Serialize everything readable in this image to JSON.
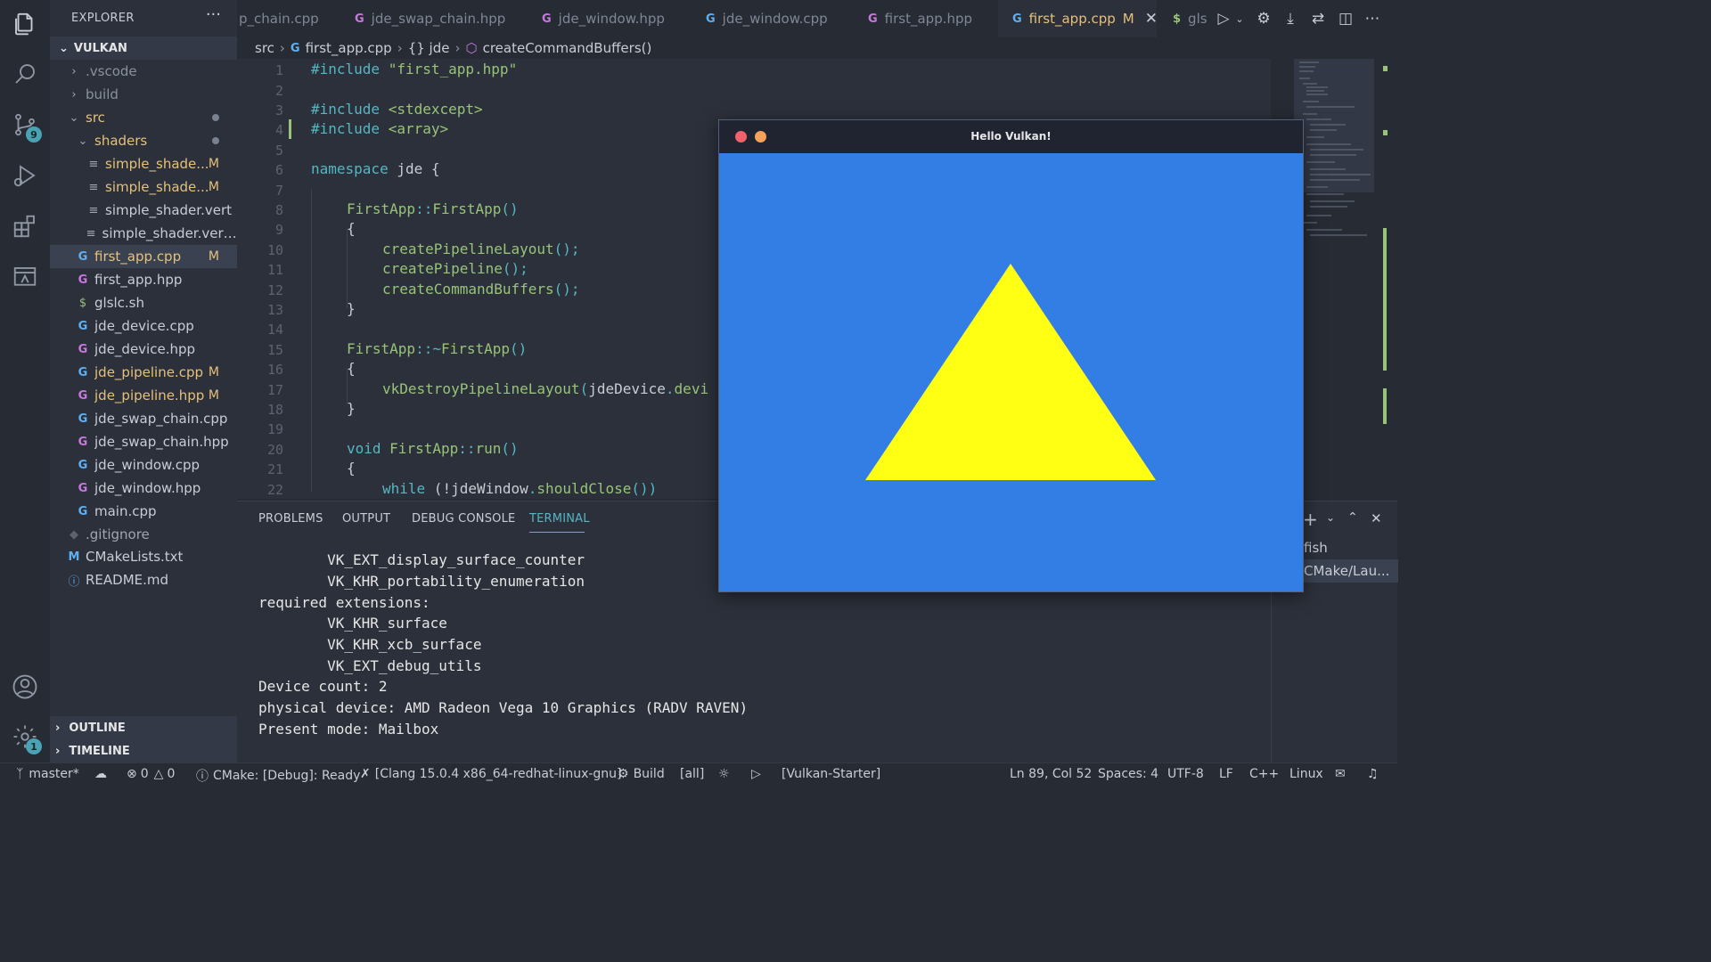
{
  "sidebar": {
    "title": "EXPLORER",
    "more": "···",
    "root": "VULKAN",
    "items": [
      {
        "label": ".vscode",
        "kind": "folder",
        "mark": ""
      },
      {
        "label": "build",
        "kind": "folder",
        "mark": ""
      },
      {
        "label": "src",
        "kind": "folder-open",
        "mark": "dot"
      },
      {
        "label": "shaders",
        "kind": "folder-open",
        "mark": "dot"
      },
      {
        "label": "simple_shade...",
        "kind": "text",
        "mark": "M"
      },
      {
        "label": "simple_shade...",
        "kind": "text",
        "mark": "M"
      },
      {
        "label": "simple_shader.vert",
        "kind": "text",
        "mark": ""
      },
      {
        "label": "simple_shader.vert....",
        "kind": "text",
        "mark": ""
      },
      {
        "label": "first_app.cpp",
        "kind": "cpp",
        "mark": "M"
      },
      {
        "label": "first_app.hpp",
        "kind": "hpp",
        "mark": ""
      },
      {
        "label": "glslc.sh",
        "kind": "sh",
        "mark": ""
      },
      {
        "label": "jde_device.cpp",
        "kind": "cpp",
        "mark": ""
      },
      {
        "label": "jde_device.hpp",
        "kind": "hpp",
        "mark": ""
      },
      {
        "label": "jde_pipeline.cpp",
        "kind": "cpp",
        "mark": "M"
      },
      {
        "label": "jde_pipeline.hpp",
        "kind": "hpp",
        "mark": "M"
      },
      {
        "label": "jde_swap_chain.cpp",
        "kind": "cpp",
        "mark": ""
      },
      {
        "label": "jde_swap_chain.hpp",
        "kind": "hpp",
        "mark": ""
      },
      {
        "label": "jde_window.cpp",
        "kind": "cpp",
        "mark": ""
      },
      {
        "label": "jde_window.hpp",
        "kind": "hpp",
        "mark": ""
      },
      {
        "label": "main.cpp",
        "kind": "cpp",
        "mark": ""
      },
      {
        "label": ".gitignore",
        "kind": "git",
        "mark": ""
      },
      {
        "label": "CMakeLists.txt",
        "kind": "cmake",
        "mark": ""
      },
      {
        "label": "README.md",
        "kind": "info",
        "mark": ""
      }
    ],
    "outline": "OUTLINE",
    "timeline": "TIMELINE",
    "scm_badge": "9",
    "settings_badge": "1"
  },
  "tabs": [
    {
      "label": "p_chain.cpp",
      "icon": ""
    },
    {
      "label": "jde_swap_chain.hpp",
      "icon": "hpp"
    },
    {
      "label": "jde_window.hpp",
      "icon": "hpp"
    },
    {
      "label": "jde_window.cpp",
      "icon": "cpp"
    },
    {
      "label": "first_app.hpp",
      "icon": "hpp"
    },
    {
      "label": "first_app.cpp",
      "icon": "cpp",
      "mark": "M"
    },
    {
      "label": "gls",
      "icon": "sh"
    }
  ],
  "breadcrumb": {
    "folder": "src",
    "file": "first_app.cpp",
    "namespace": "{} jde",
    "symbol": "createCommandBuffers()"
  },
  "editor": {
    "lines": [
      "1",
      "2",
      "3",
      "4",
      "5",
      "6",
      "7",
      "8",
      "9",
      "10",
      "11",
      "12",
      "13",
      "14",
      "15",
      "16",
      "17",
      "18",
      "19",
      "20",
      "21",
      "22"
    ],
    "code": {
      "l1_kw": "#include",
      "l1_str": "\"first_app.hpp\"",
      "l3_kw": "#include",
      "l3_str": "<stdexcept>",
      "l4_kw": "#include",
      "l4_str": "<array>",
      "l6_kw": "namespace",
      "l6_name": "jde",
      "l6_brace": "{",
      "l8_cls": "FirstApp",
      "l8_sep": "::",
      "l8_fn": "FirstApp",
      "l8_paren": "()",
      "l9": "{",
      "l10_fn": "createPipelineLayout",
      "l10_rest": "();",
      "l11_fn": "createPipeline",
      "l11_rest": "();",
      "l12_fn": "createCommandBuffers",
      "l12_rest": "();",
      "l13": "}",
      "l15_cls": "FirstApp",
      "l15_sep": "::~",
      "l15_fn": "FirstApp",
      "l15_paren": "()",
      "l16": "{",
      "l17_fn": "vkDestroyPipelineLayout",
      "l17_paren": "(",
      "l17_var": "jdeDevice",
      "l17_dot": ".",
      "l17_fn2": "devi",
      "l18": "}",
      "l20_kw": "void",
      "l20_cls": "FirstApp",
      "l20_sep": "::",
      "l20_fn": "run",
      "l20_paren": "()",
      "l21": "{",
      "l22_kw": "while",
      "l22_a": " (!",
      "l22_var": "jdeWindow",
      "l22_dot": ".",
      "l22_fn": "shouldClose",
      "l22_paren": "())"
    }
  },
  "panel": {
    "tabs": [
      "PROBLEMS",
      "OUTPUT",
      "DEBUG CONSOLE",
      "TERMINAL"
    ],
    "terminal_lines": [
      "        VK_EXT_display_surface_counter",
      "        VK_KHR_portability_enumeration",
      "required extensions:",
      "        VK_KHR_surface",
      "        VK_KHR_xcb_surface",
      "        VK_EXT_debug_utils",
      "Device count: 2",
      "physical device: AMD Radeon Vega 10 Graphics (RADV RAVEN)",
      "Present mode: Mailbox"
    ],
    "terminals": [
      "fish",
      "CMake/Lau..."
    ]
  },
  "vulkan_window": {
    "title": "Hello Vulkan!",
    "clear_color": "#337ee4",
    "triangle_color": "#ffff14"
  },
  "status": {
    "branch": "master*",
    "errors": "0",
    "warnings": "0",
    "cmake": "CMake: [Debug]: Ready",
    "kit": "[Clang 15.0.4 x86_64-redhat-linux-gnu]",
    "build": "Build",
    "target": "[all]",
    "launch_target": "[Vulkan-Starter]",
    "position": "Ln 89, Col 52",
    "spaces": "Spaces: 4",
    "encoding": "UTF-8",
    "eol": "LF",
    "language": "C++",
    "os": "Linux"
  },
  "colors": {
    "accent": "#56b6c2",
    "modified": "#e5c07b"
  }
}
